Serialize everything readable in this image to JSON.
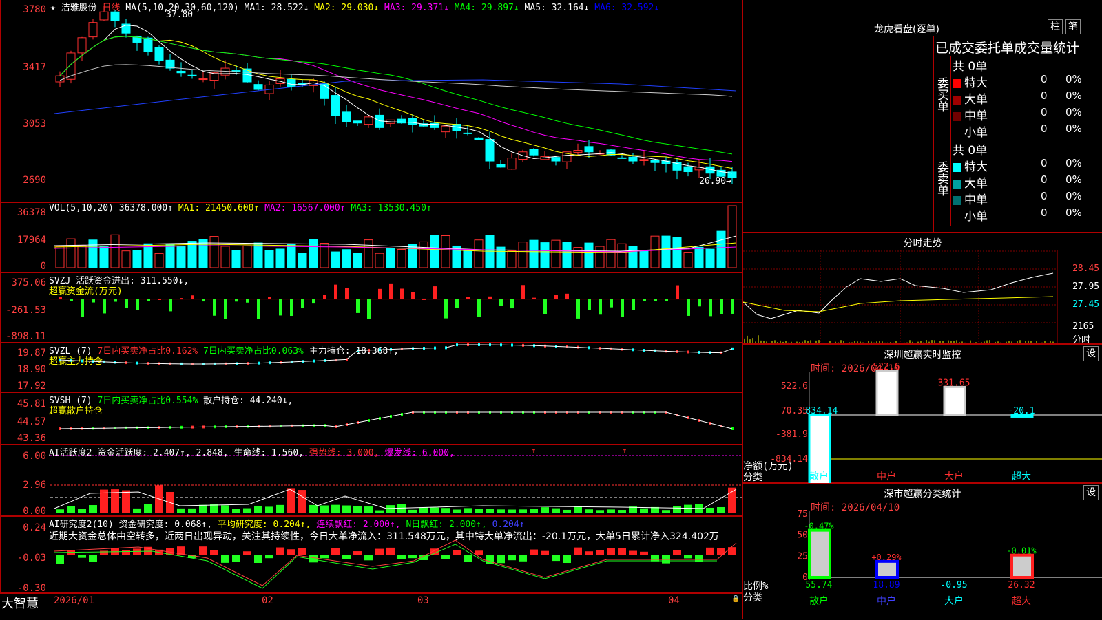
{
  "stock": {
    "star": "★",
    "name": "洁雅股份",
    "period": "日线"
  },
  "kline": {
    "ma_title": "MA(5,10,20,30,60,120)",
    "ma": [
      {
        "label": "MA1:",
        "value": "28.522↓",
        "color": "#ffffff"
      },
      {
        "label": "MA2:",
        "value": "29.030↓",
        "color": "#ffff00"
      },
      {
        "label": "MA3:",
        "value": "29.371↓",
        "color": "#ff00ff"
      },
      {
        "label": "MA4:",
        "value": "29.897↓",
        "color": "#00ff00"
      },
      {
        "label": "MA5:",
        "value": "32.164↓",
        "color": "#ffffff"
      },
      {
        "label": "MA6:",
        "value": "32.592↓",
        "color": "#0000ff"
      }
    ],
    "yticks": [
      "3780",
      "3417",
      "3053",
      "2690"
    ],
    "high_label": "37.80",
    "low_label": "26.90→"
  },
  "vol": {
    "title": "VOL(5,10,20)",
    "value": "36378.000↑",
    "ma1": "MA1: 21450.600↑",
    "ma2": "MA2: 16567.000↑",
    "ma3": "MA3: 13530.450↑",
    "yticks": [
      "36378",
      "17964",
      "0"
    ]
  },
  "svzj": {
    "title": "SVZJ",
    "line1": "活跃资金进出: 311.550↓,",
    "sub": "超赢资金流(万元)",
    "yticks": [
      "375.06",
      "-261.53",
      "-898.11"
    ]
  },
  "svzl": {
    "title": "SVZL (7)",
    "a": "7日内买卖净占比0.162%",
    "b": "7日内买卖净占比0.063%",
    "c": "主力持仓: 18.368↑,",
    "sub": "超赢主力持仓",
    "yticks": [
      "19.87",
      "18.90",
      "17.92"
    ]
  },
  "svsh": {
    "title": "SVSH (7)",
    "a": "7日内买卖净占比0.554%",
    "c": "散户持仓: 44.240↓,",
    "sub": "超赢散户持仓",
    "yticks": [
      "45.81",
      "44.57",
      "43.36"
    ]
  },
  "ai1": {
    "title": "AI活跃度2",
    "a": "资金活跃度: 2.407↑, 2.848,",
    "b": "生命线: 1.560,",
    "c": "强势线: 3.000,",
    "d": "爆发线: 6.000,",
    "yticks": [
      "6.00",
      "2.96",
      "0.00"
    ]
  },
  "ai2": {
    "title": "AI研究度2(10)",
    "a": "资金研究度: 0.068↑,",
    "b": "平均研究度: 0.204↑,",
    "c": "连续飘红: 2.000↑,",
    "d": "N日飘红: 2.000↑,",
    "e": "0.204↑",
    "comment": "近期大资金总体由空转多，近两日出现异动，关注其持续性，今日大单净流入：311.548万元，其中特大单净流出：-20.1万元，大单5日累计净入324.402万",
    "yticks": [
      "0.24",
      "-0.03",
      "-0.30"
    ]
  },
  "xaxis": {
    "brand": "大智慧",
    "labels": [
      "2026/01",
      "02",
      "03",
      "04"
    ]
  },
  "longhu": {
    "title": "龙虎看盘(逐单)",
    "btn1": "柱",
    "btn2": "笔",
    "header": "已成交委托单成交量统计",
    "buy": {
      "side": "委买单",
      "total": "共 0单",
      "rows": [
        {
          "name": "特大",
          "vol": "0",
          "pct": "0%",
          "color": "#ff0000"
        },
        {
          "name": "大单",
          "vol": "0",
          "pct": "0%",
          "color": "#a00000"
        },
        {
          "name": "中单",
          "vol": "0",
          "pct": "0%",
          "color": "#700000"
        },
        {
          "name": "小单",
          "vol": "0",
          "pct": "0%",
          "color": "#000000"
        }
      ]
    },
    "sell": {
      "side": "委卖单",
      "total": "共 0单",
      "rows": [
        {
          "name": "特大",
          "vol": "0",
          "pct": "0%",
          "color": "#00ffff"
        },
        {
          "name": "大单",
          "vol": "0",
          "pct": "0%",
          "color": "#00a0a0"
        },
        {
          "name": "中单",
          "vol": "0",
          "pct": "0%",
          "color": "#007070"
        },
        {
          "name": "小单",
          "vol": "0",
          "pct": "0%",
          "color": "#000000"
        }
      ]
    }
  },
  "intraday": {
    "title": "分时走势",
    "yticks": [
      "28.45",
      "27.95",
      "27.45"
    ],
    "vol_label": "2165",
    "unit": "分时"
  },
  "monitor": {
    "title": "深圳超赢实时监控",
    "set": "设",
    "time": "时间: 2026/04/10",
    "ylabel": "净额(万元)",
    "xlabel": "分类",
    "yticks": [
      "522.6",
      "70.35",
      "-381.9",
      "-834.14"
    ]
  },
  "stat": {
    "title": "深市超赢分类统计",
    "set": "设",
    "time": "时间: 2026/04/10",
    "ylabel": "比例%",
    "xlabel": "分类",
    "yticks": [
      "75",
      "50",
      "25",
      "0"
    ]
  },
  "chart_data": [
    {
      "type": "bar",
      "name": "monitor",
      "categories": [
        "散户",
        "中户",
        "大户",
        "超大"
      ],
      "values": [
        -834.14,
        522.6,
        331.65,
        -20.1
      ],
      "ylim": [
        -834.14,
        522.6
      ]
    },
    {
      "type": "bar",
      "name": "stat",
      "categories": [
        "散户",
        "中户",
        "大户",
        "超大"
      ],
      "values": [
        55.74,
        18.89,
        -0.95,
        26.32
      ],
      "changes": [
        "-0.47%",
        "+0.29%",
        "",
        "-0.01%"
      ],
      "ylim": [
        0,
        75
      ]
    }
  ]
}
